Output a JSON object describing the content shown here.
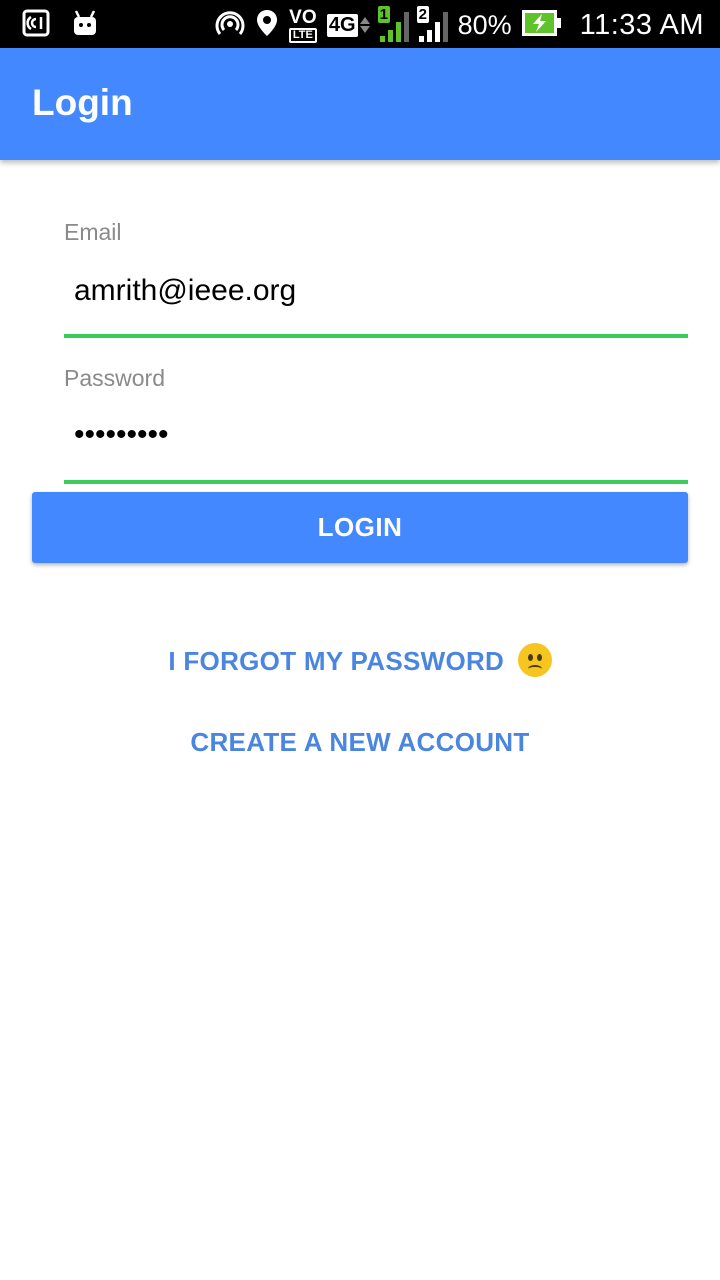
{
  "status_bar": {
    "time": "11:33 AM",
    "battery": "80%",
    "volte_top": "VO",
    "volte_bottom": "LTE",
    "network": "4G",
    "sim1": "1",
    "sim2": "2",
    "icons": [
      "nfc-icon",
      "android-notification-icon",
      "hotspot-icon",
      "location-icon",
      "volte-icon",
      "4g-icon",
      "signal-sim1-icon",
      "signal-sim2-icon",
      "battery-charging-icon"
    ]
  },
  "app_bar": {
    "title": "Login"
  },
  "form": {
    "email": {
      "label": "Email",
      "value": "amrith@ieee.org"
    },
    "password": {
      "label": "Password",
      "value": "•••••••••"
    },
    "login_label": "LOGIN"
  },
  "links": {
    "forgot_password": "I FORGOT MY PASSWORD",
    "create_account": "CREATE A NEW ACCOUNT"
  },
  "colors": {
    "primary": "#4488ff",
    "field_underline": "#3ccc5c",
    "link": "#4a86e0",
    "sim1_signal": "#5fc32a"
  }
}
